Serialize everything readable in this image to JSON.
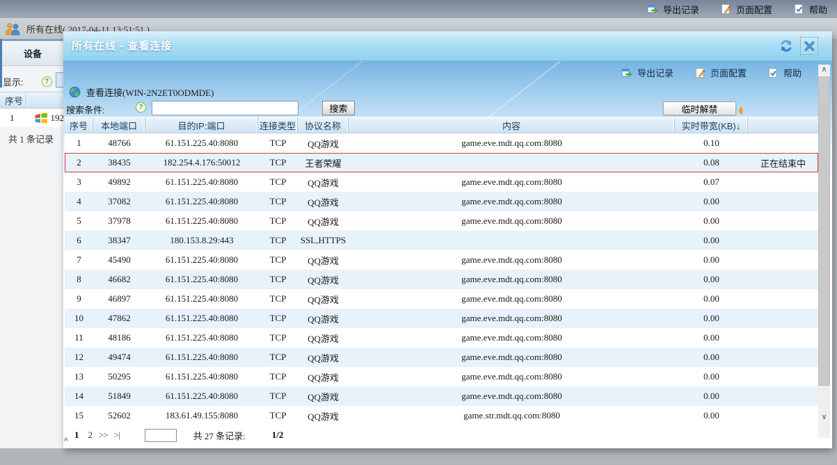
{
  "colors": {
    "title_bar_blue": "#8fd2f0",
    "table_header_blue": "#cfe2f1",
    "row_stripe_blue": "#e7f2fb",
    "highlight_red": "#d5383a",
    "icon_blue": "#2e83c9",
    "icon_green": "#52b043",
    "icon_orange": "#f59a23"
  },
  "page": {
    "top_toolbar": {
      "export": "导出记录",
      "page_config": "页面配置",
      "help": "帮助"
    },
    "header": {
      "title": "所有在线( 2017-04-11 13:51:51 )"
    },
    "left_panel": {
      "tab": "设备",
      "display_label": "显示:",
      "col_header": "序号",
      "row_index": "1",
      "row_ip": "192",
      "total": "共 1 条记录"
    }
  },
  "dialog": {
    "title": "所有在线 - 查看连接",
    "toolbar": {
      "export": "导出记录",
      "page_config": "页面配置",
      "help": "帮助"
    },
    "breadcrumb": "查看连接(WIN-2N2ET0ODMDE)",
    "search": {
      "label": "搜索条件:",
      "value": "",
      "button": "搜索",
      "unban_button": "临时解禁"
    },
    "table": {
      "headers": [
        "序号",
        "本地端口",
        "目的IP:端口",
        "连接类型",
        "协议名称",
        "内容",
        "实时带宽(KB)↓",
        ""
      ],
      "rows": [
        {
          "seq": "1",
          "local_port": "48766",
          "dest": "61.151.225.40:8080",
          "conn_type": "TCP",
          "protocol": "QQ游戏",
          "content": "game.eve.mdt.qq.com:8080",
          "bandwidth": "0.10",
          "status": "",
          "highlight": false
        },
        {
          "seq": "2",
          "local_port": "38435",
          "dest": "182.254.4.176:50012",
          "conn_type": "TCP",
          "protocol": "王者荣耀",
          "content": "",
          "bandwidth": "0.08",
          "status": "正在结束中",
          "highlight": true
        },
        {
          "seq": "3",
          "local_port": "49892",
          "dest": "61.151.225.40:8080",
          "conn_type": "TCP",
          "protocol": "QQ游戏",
          "content": "game.eve.mdt.qq.com:8080",
          "bandwidth": "0.07",
          "status": "",
          "highlight": false
        },
        {
          "seq": "4",
          "local_port": "37082",
          "dest": "61.151.225.40:8080",
          "conn_type": "TCP",
          "protocol": "QQ游戏",
          "content": "game.eve.mdt.qq.com:8080",
          "bandwidth": "0.00",
          "status": "",
          "highlight": false
        },
        {
          "seq": "5",
          "local_port": "37978",
          "dest": "61.151.225.40:8080",
          "conn_type": "TCP",
          "protocol": "QQ游戏",
          "content": "game.eve.mdt.qq.com:8080",
          "bandwidth": "0.00",
          "status": "",
          "highlight": false
        },
        {
          "seq": "6",
          "local_port": "38347",
          "dest": "180.153.8.29:443",
          "conn_type": "TCP",
          "protocol": "SSL,HTTPS",
          "content": "",
          "bandwidth": "0.00",
          "status": "",
          "highlight": false
        },
        {
          "seq": "7",
          "local_port": "45490",
          "dest": "61.151.225.40:8080",
          "conn_type": "TCP",
          "protocol": "QQ游戏",
          "content": "game.eve.mdt.qq.com:8080",
          "bandwidth": "0.00",
          "status": "",
          "highlight": false
        },
        {
          "seq": "8",
          "local_port": "46682",
          "dest": "61.151.225.40:8080",
          "conn_type": "TCP",
          "protocol": "QQ游戏",
          "content": "game.eve.mdt.qq.com:8080",
          "bandwidth": "0.00",
          "status": "",
          "highlight": false
        },
        {
          "seq": "9",
          "local_port": "46897",
          "dest": "61.151.225.40:8080",
          "conn_type": "TCP",
          "protocol": "QQ游戏",
          "content": "game.eve.mdt.qq.com:8080",
          "bandwidth": "0.00",
          "status": "",
          "highlight": false
        },
        {
          "seq": "10",
          "local_port": "47862",
          "dest": "61.151.225.40:8080",
          "conn_type": "TCP",
          "protocol": "QQ游戏",
          "content": "game.eve.mdt.qq.com:8080",
          "bandwidth": "0.00",
          "status": "",
          "highlight": false
        },
        {
          "seq": "11",
          "local_port": "48186",
          "dest": "61.151.225.40:8080",
          "conn_type": "TCP",
          "protocol": "QQ游戏",
          "content": "game.eve.mdt.qq.com:8080",
          "bandwidth": "0.00",
          "status": "",
          "highlight": false
        },
        {
          "seq": "12",
          "local_port": "49474",
          "dest": "61.151.225.40:8080",
          "conn_type": "TCP",
          "protocol": "QQ游戏",
          "content": "game.eve.mdt.qq.com:8080",
          "bandwidth": "0.00",
          "status": "",
          "highlight": false
        },
        {
          "seq": "13",
          "local_port": "50295",
          "dest": "61.151.225.40:8080",
          "conn_type": "TCP",
          "protocol": "QQ游戏",
          "content": "game.eve.mdt.qq.com:8080",
          "bandwidth": "0.00",
          "status": "",
          "highlight": false
        },
        {
          "seq": "14",
          "local_port": "51849",
          "dest": "61.151.225.40:8080",
          "conn_type": "TCP",
          "protocol": "QQ游戏",
          "content": "game.eve.mdt.qq.com:8080",
          "bandwidth": "0.00",
          "status": "",
          "highlight": false
        },
        {
          "seq": "15",
          "local_port": "52602",
          "dest": "183.61.49.155:8080",
          "conn_type": "TCP",
          "protocol": "QQ游戏",
          "content": "game.str.mdt.qq.com:8080",
          "bandwidth": "0.00",
          "status": "",
          "highlight": false
        }
      ]
    },
    "pagination": {
      "page_current": "1",
      "page_2": "2",
      "next": ">>",
      "last": ">|",
      "page_input": "",
      "total": "共 27 条记录:",
      "position": "1/2"
    }
  }
}
